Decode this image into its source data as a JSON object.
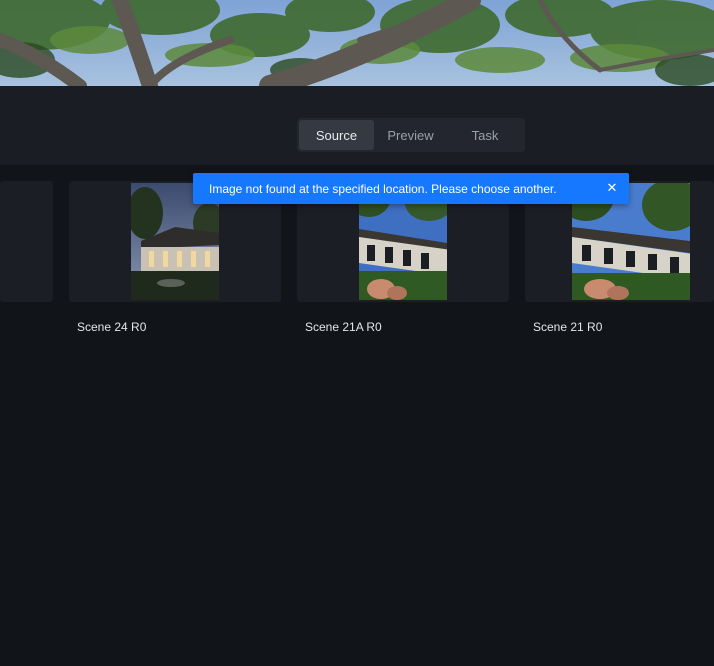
{
  "tabs": {
    "items": [
      {
        "label": "Source",
        "active": true
      },
      {
        "label": "Preview",
        "active": false
      },
      {
        "label": "Task",
        "active": false
      }
    ]
  },
  "scenes": [
    {
      "label": "Scene 24 R0"
    },
    {
      "label": "Scene 21A R0"
    },
    {
      "label": "Scene 21 R0"
    }
  ],
  "toast": {
    "message": "Image not found at the specified location. Please choose another.",
    "close_icon": "close-icon",
    "color": "#1677ff"
  },
  "colors": {
    "background": "#111419",
    "header": "#1a1d24",
    "card": "#1b1e25",
    "tab_active": "#353941"
  }
}
